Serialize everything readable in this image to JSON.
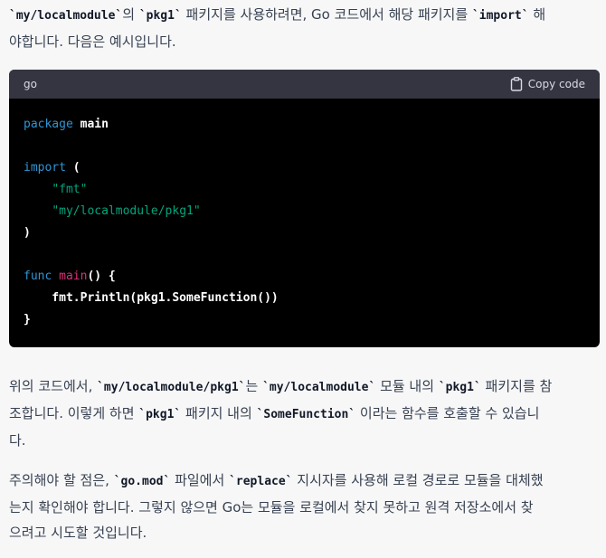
{
  "paragraph1": {
    "code1": "`my/localmodule`",
    "text1": "의 ",
    "code2": "`pkg1`",
    "text2": " 패키지를 사용하려면, Go 코드에서 해당 패키지를 ",
    "code3": "`import`",
    "text3": " 해",
    "line2": "야합니다. 다음은 예시입니다."
  },
  "code_block": {
    "language": "go",
    "copy_label": "Copy code",
    "copy_icon": "clipboard-icon",
    "lines": {
      "l1_kw": "package",
      "l1_rest": " main",
      "l3_kw": "import",
      "l3_rest": " (",
      "l4_indent": "    ",
      "l4_str": "\"fmt\"",
      "l5_indent": "    ",
      "l5_str": "\"my/localmodule/pkg1\"",
      "l6": ")",
      "l8_kw": "func",
      "l8_sp": " ",
      "l8_fn": "main",
      "l8_rest": "() {",
      "l9": "    fmt.Println(pkg1.SomeFunction())",
      "l10": "}"
    },
    "colors": {
      "keyword": "#2e95d3",
      "string": "#00a67d",
      "function": "#df3079",
      "header_bg": "#343541",
      "body_bg": "#000000"
    }
  },
  "paragraph2": {
    "t1": "위의 코드에서, ",
    "c1": "`my/localmodule/pkg1`",
    "t2": "는 ",
    "c2": "`my/localmodule`",
    "t3": " 모듈 내의 ",
    "c3": "`pkg1`",
    "t4": " 패키지를 참",
    "l2_t1": "조합니다. 이렇게 하면 ",
    "l2_c1": "`pkg1`",
    "l2_t2": " 패키지 내의 ",
    "l2_c2": "`SomeFunction`",
    "l2_t3": " 이라는 함수를 호출할 수 있습니",
    "l3": "다."
  },
  "paragraph3": {
    "t1": "주의해야 할 점은, ",
    "c1": "`go.mod`",
    "t2": " 파일에서 ",
    "c2": "`replace`",
    "t3": " 지시자를 사용해 로컬 경로로 모듈을 대체했",
    "l2": "는지 확인해야 합니다. 그렇지 않으면 Go는 모듈을 로컬에서 찾지 못하고 원격 저장소에서 찾",
    "l3": "으려고 시도할 것입니다."
  }
}
